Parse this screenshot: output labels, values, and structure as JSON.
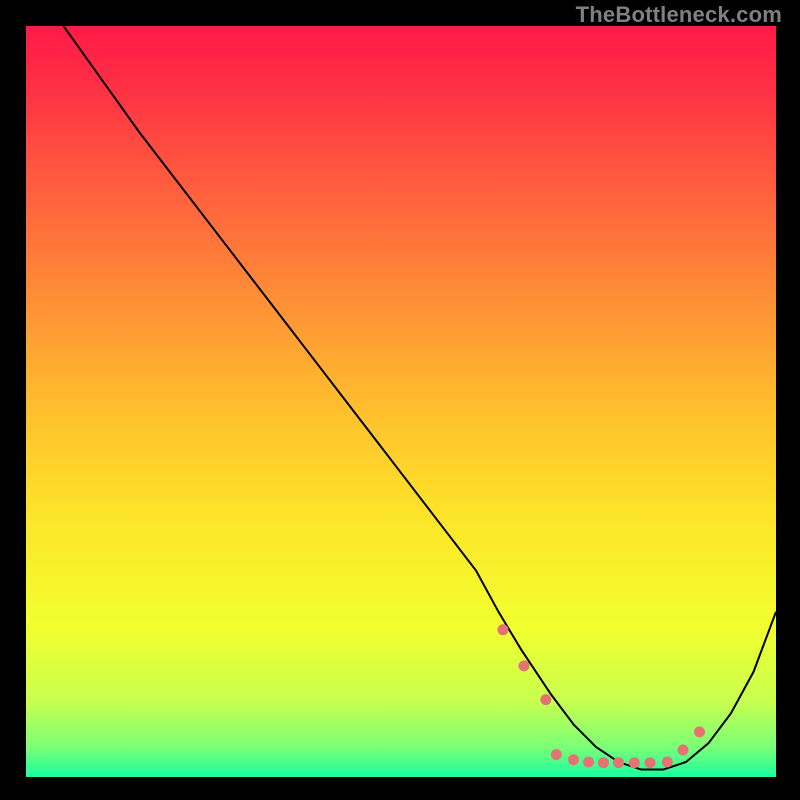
{
  "watermark": "TheBottleneck.com",
  "chart_data": {
    "type": "line",
    "title": "",
    "xlabel": "",
    "ylabel": "",
    "xlim": [
      0,
      100
    ],
    "ylim": [
      0,
      100
    ],
    "grid": false,
    "legend": false,
    "background": {
      "type": "vertical-gradient",
      "stops": [
        {
          "offset": 0.0,
          "color": "#ff1a47"
        },
        {
          "offset": 0.07,
          "color": "#ff2c45"
        },
        {
          "offset": 0.2,
          "color": "#ff593f"
        },
        {
          "offset": 0.35,
          "color": "#ff8a37"
        },
        {
          "offset": 0.5,
          "color": "#ffbc2e"
        },
        {
          "offset": 0.65,
          "color": "#fde429"
        },
        {
          "offset": 0.8,
          "color": "#f2ff2e"
        },
        {
          "offset": 0.9,
          "color": "#c7ff4f"
        },
        {
          "offset": 0.96,
          "color": "#7bff76"
        },
        {
          "offset": 1.0,
          "color": "#19ffa0"
        }
      ]
    },
    "series": [
      {
        "name": "curve",
        "color": "#000000",
        "width": 2,
        "x": [
          5,
          10,
          15,
          20,
          25,
          30,
          35,
          40,
          45,
          50,
          55,
          60,
          63,
          66,
          70,
          73,
          76,
          79,
          82,
          85,
          88,
          91,
          94,
          97,
          100
        ],
        "y": [
          100,
          93,
          86,
          79.5,
          73,
          66.5,
          60,
          53.5,
          47,
          40.5,
          34,
          27.5,
          22,
          17,
          11,
          7,
          4,
          2,
          1,
          1,
          2,
          4.5,
          8.5,
          14,
          22
        ]
      }
    ],
    "highlight": {
      "name": "dots",
      "color": "#e57373",
      "radius": 5.5,
      "x": [
        63.6,
        66.4,
        69.3,
        70.7,
        73.0,
        75.0,
        77.0,
        79.0,
        81.1,
        83.2,
        85.5,
        87.6,
        89.8
      ],
      "y": [
        19.6,
        14.8,
        10.3,
        3.0,
        2.3,
        2.0,
        1.9,
        1.9,
        1.9,
        1.9,
        2.0,
        3.6,
        6.0
      ]
    }
  },
  "colors": {
    "frame": "#000000",
    "watermark": "#808080"
  }
}
